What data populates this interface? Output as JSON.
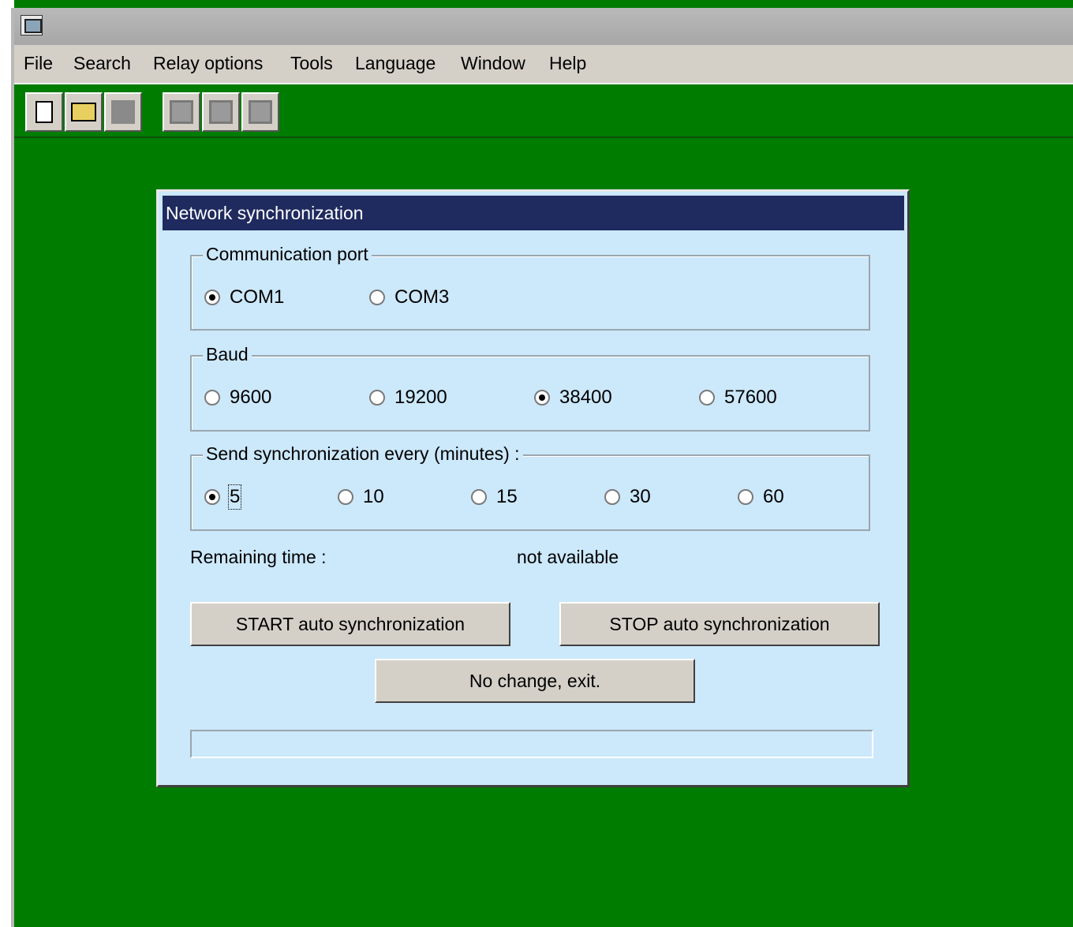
{
  "menu": {
    "file": "File",
    "search": "Search",
    "relay_options": "Relay options",
    "tools": "Tools",
    "language": "Language",
    "window": "Window",
    "help": "Help"
  },
  "toolbar": {
    "icons": [
      "new-document-icon",
      "open-folder-icon",
      "save-icon-disabled",
      "relay-icon-disabled",
      "grid-icon-disabled",
      "table-icon-disabled"
    ]
  },
  "dialog": {
    "title": "Network synchronization",
    "comm_port": {
      "legend": "Communication port",
      "options": [
        "COM1",
        "COM3"
      ],
      "selected": "COM1"
    },
    "baud": {
      "legend": "Baud",
      "options": [
        "9600",
        "19200",
        "38400",
        "57600"
      ],
      "selected": "38400"
    },
    "interval": {
      "legend": "Send synchronization every (minutes) :",
      "options": [
        "5",
        "10",
        "15",
        "30",
        "60"
      ],
      "selected": "5"
    },
    "remaining_label": "Remaining time :",
    "remaining_value": "not available",
    "start_button": "START auto synchronization",
    "stop_button": "STOP auto synchronization",
    "exit_button": "No change, exit.",
    "status_text": ""
  },
  "colors": {
    "desktop": "#007c00",
    "dialog_bg": "#cce8fb",
    "title_bg": "#1f2a5e"
  }
}
